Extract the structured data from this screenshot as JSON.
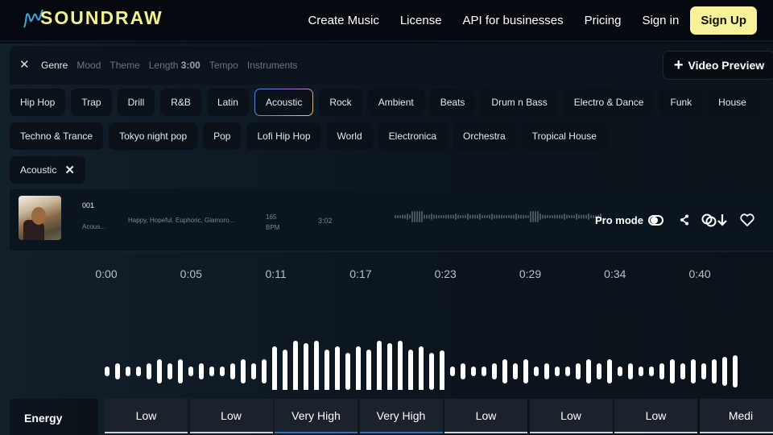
{
  "header": {
    "logo": "SOUNDRAW",
    "nav": [
      "Create Music",
      "License",
      "API for businesses",
      "Pricing",
      "Sign in"
    ],
    "signup": "Sign Up",
    "accent": "#f7f19a"
  },
  "filters": {
    "tabs": [
      {
        "label": "Genre",
        "active": true
      },
      {
        "label": "Mood"
      },
      {
        "label": "Theme"
      },
      {
        "label": "Length",
        "value": "3:00"
      },
      {
        "label": "Tempo"
      },
      {
        "label": "Instruments"
      }
    ],
    "video_preview": "Video Preview"
  },
  "genres": {
    "row1": [
      "Hip Hop",
      "Trap",
      "Drill",
      "R&B",
      "Latin",
      "Acoustic",
      "Rock",
      "Ambient",
      "Beats",
      "Drum n Bass",
      "Electro & Dance",
      "Funk",
      "House"
    ],
    "row2": [
      "Techno & Trance",
      "Tokyo night pop",
      "Pop",
      "Lofi Hip Hop",
      "World",
      "Electronica",
      "Orchestra",
      "Tropical House"
    ],
    "selected": "Acoustic"
  },
  "selected_filter": {
    "label": "Acoustic"
  },
  "track": {
    "name": "001",
    "genre": "Acous...",
    "moods": "Happy, Hopeful, Euphoric, Glamoro...",
    "bpm": "165",
    "bpm_unit": "BPM",
    "duration": "3:02",
    "pro_mode": "Pro mode"
  },
  "timeline": [
    "0:00",
    "0:05",
    "0:11",
    "0:17",
    "0:23",
    "0:29",
    "0:34",
    "0:40"
  ],
  "energy": {
    "label": "Energy",
    "levels": [
      "Low",
      "Low",
      "Very High",
      "Very High",
      "Low",
      "Low",
      "Low",
      "Medi"
    ]
  }
}
